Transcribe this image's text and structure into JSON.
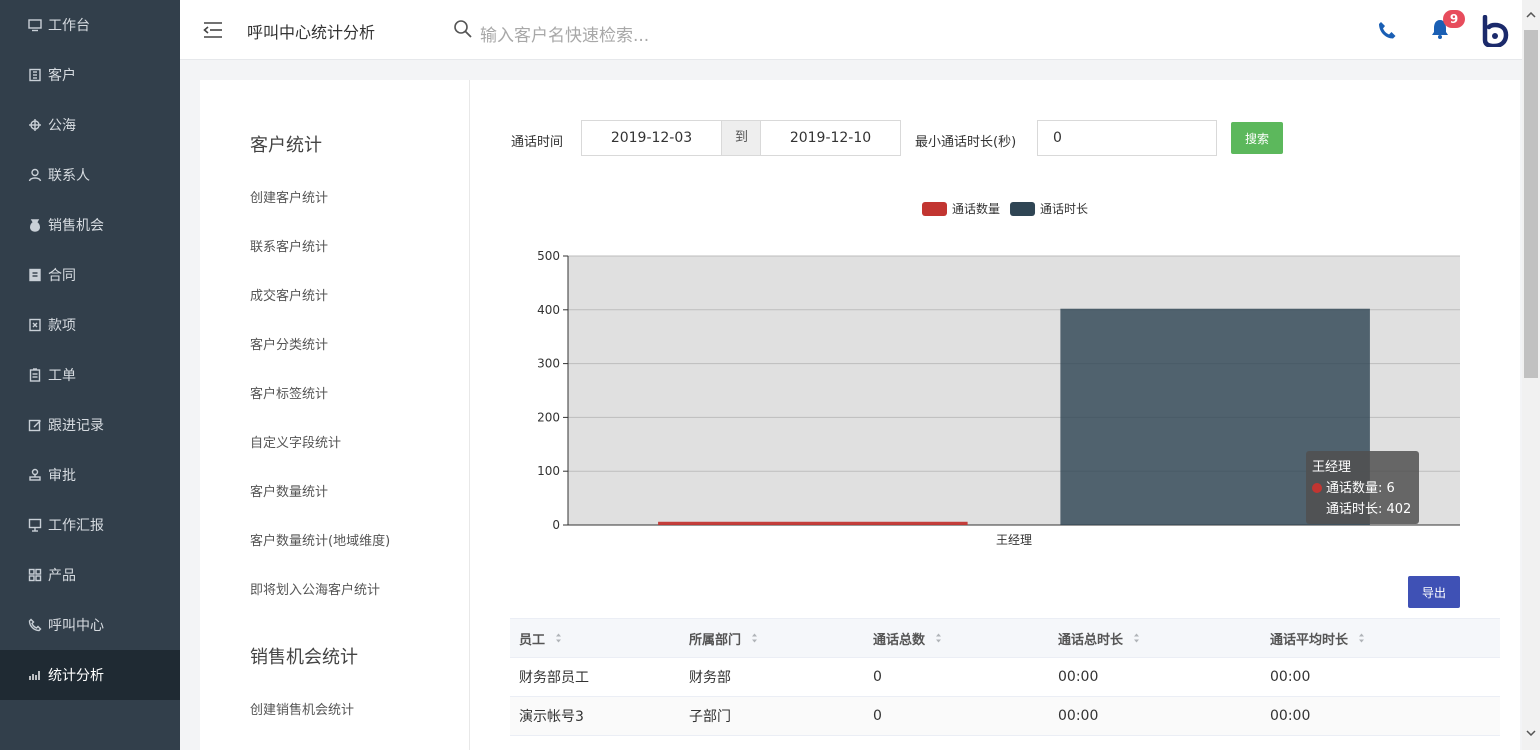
{
  "sidebar": {
    "items": [
      {
        "label": "工作台",
        "icon": "monitor-icon"
      },
      {
        "label": "客户",
        "icon": "building-icon"
      },
      {
        "label": "公海",
        "icon": "ship-icon"
      },
      {
        "label": "联系人",
        "icon": "user-icon"
      },
      {
        "label": "销售机会",
        "icon": "money-bag-icon"
      },
      {
        "label": "合同",
        "icon": "contract-icon"
      },
      {
        "label": "款项",
        "icon": "payment-icon"
      },
      {
        "label": "工单",
        "icon": "clipboard-icon"
      },
      {
        "label": "跟进记录",
        "icon": "edit-icon"
      },
      {
        "label": "审批",
        "icon": "stamp-icon"
      },
      {
        "label": "工作汇报",
        "icon": "presentation-icon"
      },
      {
        "label": "产品",
        "icon": "grid-icon"
      },
      {
        "label": "呼叫中心",
        "icon": "phone-icon"
      },
      {
        "label": "统计分析",
        "icon": "bar-chart-icon",
        "active": true
      }
    ]
  },
  "header": {
    "title": "呼叫中心统计分析",
    "search_placeholder": "输入客户名快速检索...",
    "notification_count": "9"
  },
  "subnav": {
    "group1_title": "客户统计",
    "group1_items": [
      "创建客户统计",
      "联系客户统计",
      "成交客户统计",
      "客户分类统计",
      "客户标签统计",
      "自定义字段统计",
      "客户数量统计",
      "客户数量统计(地域维度)",
      "即将划入公海客户统计"
    ],
    "group2_title": "销售机会统计",
    "group2_items": [
      "创建销售机会统计"
    ]
  },
  "filters": {
    "time_label": "通话时间",
    "start_date": "2019-12-03",
    "to_label": "到",
    "end_date": "2019-12-10",
    "min_duration_label": "最小通话时长(秒)",
    "min_duration_value": "0",
    "search_button": "搜索"
  },
  "chart_data": {
    "type": "bar",
    "categories": [
      "王经理"
    ],
    "series": [
      {
        "name": "通话数量",
        "values": [
          6
        ],
        "color": "#c23531"
      },
      {
        "name": "通话时长",
        "values": [
          402
        ],
        "color": "#2f4554"
      }
    ],
    "ylim": [
      0,
      500
    ],
    "yticks": [
      0,
      100,
      200,
      300,
      400,
      500
    ],
    "legend_position": "top-center",
    "grid": true
  },
  "tooltip": {
    "title": "王经理",
    "line1": "通话数量: 6",
    "line2": "通话时长: 402"
  },
  "export_button": "导出",
  "table": {
    "columns": [
      "员工",
      "所属部门",
      "通话总数",
      "通话总时长",
      "通话平均时长"
    ],
    "rows": [
      [
        "财务部员工",
        "财务部",
        "0",
        "00:00",
        "00:00"
      ],
      [
        "演示帐号3",
        "子部门",
        "0",
        "00:00",
        "00:00"
      ]
    ]
  }
}
